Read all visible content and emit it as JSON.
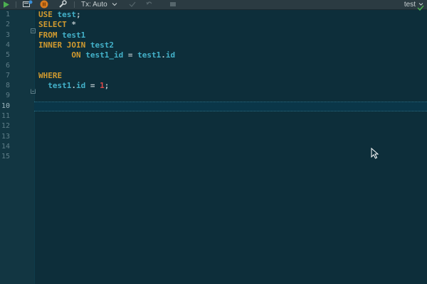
{
  "toolbar": {
    "tx_label": "Tx: Auto",
    "schema_label": "test",
    "icons": [
      "run-icon",
      "console-icon",
      "stop-icon",
      "wrench-icon",
      "chevron-down-icon",
      "commit-icon",
      "rollback-icon",
      "square-icon"
    ]
  },
  "editor": {
    "line_numbers": [
      "1",
      "2",
      "3",
      "4",
      "5",
      "6",
      "7",
      "8",
      "9",
      "10",
      "11",
      "12",
      "13",
      "14",
      "15"
    ],
    "current_line": "10",
    "code": [
      [
        {
          "t": "USE",
          "c": "kw"
        },
        {
          "t": " "
        },
        {
          "t": "test",
          "c": "id"
        },
        {
          "t": ";",
          "c": "op"
        }
      ],
      [
        {
          "t": "SELECT",
          "c": "kw"
        },
        {
          "t": " "
        },
        {
          "t": "*",
          "c": "op"
        }
      ],
      [
        {
          "t": "FROM",
          "c": "kw"
        },
        {
          "t": " "
        },
        {
          "t": "test1",
          "c": "id"
        }
      ],
      [
        {
          "t": "INNER JOIN",
          "c": "kw"
        },
        {
          "t": " "
        },
        {
          "t": "test2",
          "c": "id"
        }
      ],
      [
        {
          "t": "       "
        },
        {
          "t": "ON",
          "c": "kw"
        },
        {
          "t": " "
        },
        {
          "t": "test1_id",
          "c": "id"
        },
        {
          "t": " = ",
          "c": "op"
        },
        {
          "t": "test1",
          "c": "id"
        },
        {
          "t": ".",
          "c": "op"
        },
        {
          "t": "id",
          "c": "id"
        }
      ],
      [],
      [
        {
          "t": "WHERE",
          "c": "kw"
        }
      ],
      [
        {
          "t": "  "
        },
        {
          "t": "test1",
          "c": "id"
        },
        {
          "t": ".",
          "c": "op"
        },
        {
          "t": "id",
          "c": "id"
        },
        {
          "t": " = ",
          "c": "op"
        },
        {
          "t": "1",
          "c": "num"
        },
        {
          "t": ";",
          "c": "op"
        }
      ]
    ]
  },
  "colors": {
    "background": "#0d2e3a",
    "keyword": "#d19a2f",
    "identifier": "#43b1c9",
    "number": "#e04a4a",
    "run_green": "#4caf50"
  }
}
